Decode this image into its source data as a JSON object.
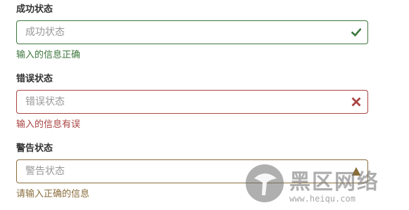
{
  "colors": {
    "success": "#3c763d",
    "error": "#a94442",
    "warning": "#8a6d3b"
  },
  "success_group": {
    "label": "成功状态",
    "placeholder": "成功状态",
    "icon": "check-icon",
    "help": "输入的信息正确"
  },
  "error_group": {
    "label": "错误状态",
    "placeholder": "错误状态",
    "icon": "close-icon",
    "help": "输入的信息有误"
  },
  "warning_group": {
    "label": "警告状态",
    "placeholder": "警告状态",
    "icon": "warning-icon",
    "help": "请输入正确的信息"
  },
  "watermark": {
    "title": "黑区网络",
    "url": "www.heiqu.com"
  }
}
